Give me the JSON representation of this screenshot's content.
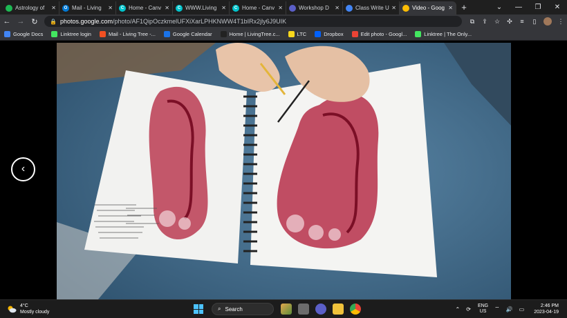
{
  "browser": {
    "tabs": [
      {
        "label": "Astrology of",
        "color": "#1db954",
        "glyph": ""
      },
      {
        "label": "Mail - Living",
        "color": "#0078d4",
        "glyph": "O"
      },
      {
        "label": "Home - Canv",
        "color": "#00c4cc",
        "glyph": "C"
      },
      {
        "label": "WWW.Living",
        "color": "#00c4cc",
        "glyph": "C"
      },
      {
        "label": "Home - Canv",
        "color": "#00c4cc",
        "glyph": "C"
      },
      {
        "label": "Workshop D",
        "color": "#5b5fc7",
        "glyph": ""
      },
      {
        "label": "Class Write U",
        "color": "#4285f4",
        "glyph": ""
      },
      {
        "label": "Video - Goog",
        "color": "#fbbc04",
        "glyph": ""
      }
    ],
    "new_tab_label": "+",
    "url_host": "photos.google.com",
    "url_path": "/photo/AF1QipOczkmelUFXiXarLPHKNWW4T1bIRx2jly6J9UIK",
    "bookmarks": [
      {
        "label": "Google Docs",
        "color": "#4285f4"
      },
      {
        "label": "Linktree login",
        "color": "#43e660"
      },
      {
        "label": "Mail - Living Tree -...",
        "color": "#f25022"
      },
      {
        "label": "Google Calendar",
        "color": "#1a73e8"
      },
      {
        "label": "Home | LivingTree.c...",
        "color": "#222222"
      },
      {
        "label": "LTC",
        "color": "#f9d71c"
      },
      {
        "label": "Dropbox",
        "color": "#0061ff"
      },
      {
        "label": "Edit photo - Googl...",
        "color": "#ea4335"
      },
      {
        "label": "Linktree | The Only...",
        "color": "#43e660"
      }
    ]
  },
  "viewer": {
    "prev_label": "‹"
  },
  "taskbar": {
    "weather_temp": "4°C",
    "weather_desc": "Mostly cloudy",
    "search_label": "Search",
    "lang_top": "ENG",
    "lang_bottom": "US",
    "time": "2:46 PM",
    "date": "2023-04-19"
  }
}
